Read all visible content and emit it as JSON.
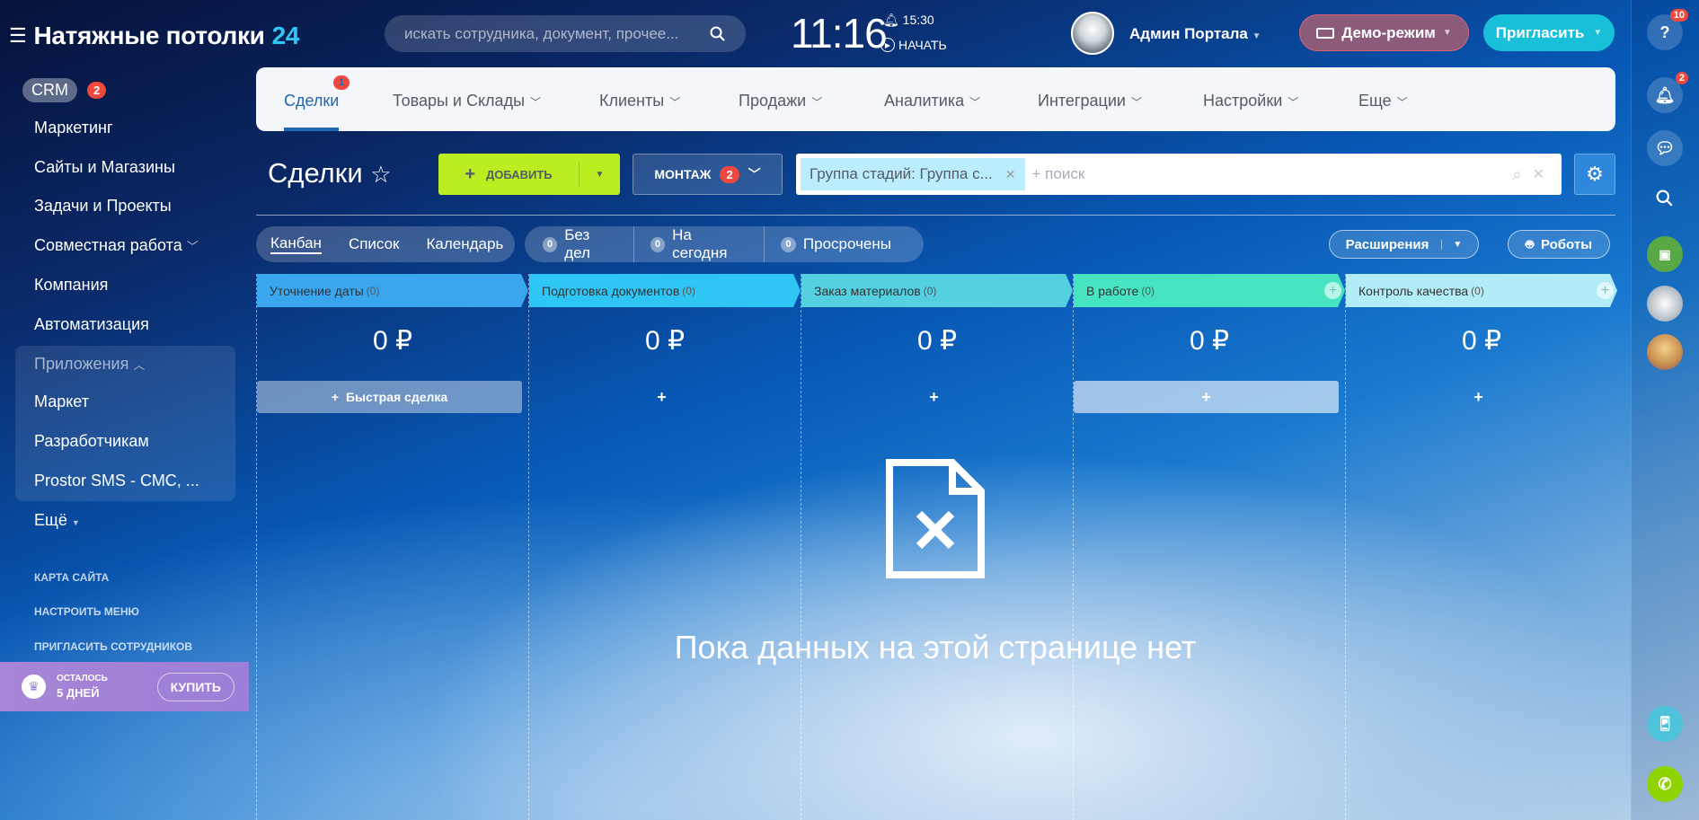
{
  "header": {
    "title": "Натяжные потолки",
    "title_num": "24",
    "search_placeholder": "искать сотрудника, документ, прочее...",
    "clock": "11:16",
    "alarm": "15:30",
    "start": "НАЧАТЬ",
    "user": "Админ Портала",
    "demo": "Демо-режим",
    "invite": "Пригласить"
  },
  "right_bar": {
    "help_badge": "10",
    "notif_badge": "2"
  },
  "sidebar": {
    "crm": "CRM",
    "crm_badge": "2",
    "items": [
      "Маркетинг",
      "Сайты и Магазины",
      "Задачи и Проекты",
      "Совместная работа",
      "Компания",
      "Автоматизация"
    ],
    "apps": "Приложения",
    "apps_items": [
      "Маркет",
      "Разработчикам",
      "Prostor SMS - СМС, ..."
    ],
    "more": "Ещё",
    "links": [
      "КАРТА САЙТА",
      "НАСТРОИТЬ МЕНЮ",
      "ПРИГЛАСИТЬ СОТРУДНИКОВ"
    ],
    "trial_label": "ОСТАЛОСЬ",
    "trial_days": "5 ДНЕЙ",
    "buy": "КУПИТЬ"
  },
  "nav": {
    "tabs": [
      "Сделки",
      "Товары и Склады",
      "Клиенты",
      "Продажи",
      "Аналитика",
      "Интеграции",
      "Настройки",
      "Еще"
    ],
    "deals_badge": "1"
  },
  "toolbar": {
    "title": "Сделки",
    "add": "ДОБАВИТЬ",
    "category": "МОНТАЖ",
    "category_badge": "2",
    "filter_chip": "Группа стадий: Группа с...",
    "filter_placeholder": "+ поиск"
  },
  "views": [
    "Канбан",
    "Список",
    "Календарь"
  ],
  "counters": [
    {
      "n": "0",
      "label": "Без дел"
    },
    {
      "n": "0",
      "label": "На сегодня"
    },
    {
      "n": "0",
      "label": "Просрочены"
    }
  ],
  "extensions": "Расширения",
  "robots": "Роботы",
  "columns": [
    {
      "name": "Уточнение даты",
      "count": "(0)",
      "sum": "0 ₽",
      "color": "#3aa6ee",
      "quick": "Быстрая сделка"
    },
    {
      "name": "Подготовка документов",
      "count": "(0)",
      "sum": "0 ₽",
      "color": "#2fc6f6"
    },
    {
      "name": "Заказ материалов",
      "count": "(0)",
      "sum": "0 ₽",
      "color": "#55d0e0"
    },
    {
      "name": "В работе",
      "count": "(0)",
      "sum": "0 ₽",
      "color": "#47e4c2"
    },
    {
      "name": "Контроль качества",
      "count": "(0)",
      "sum": "0 ₽",
      "color": "#b2ecf7"
    }
  ],
  "empty_text": "Пока данных на этой странице нет"
}
